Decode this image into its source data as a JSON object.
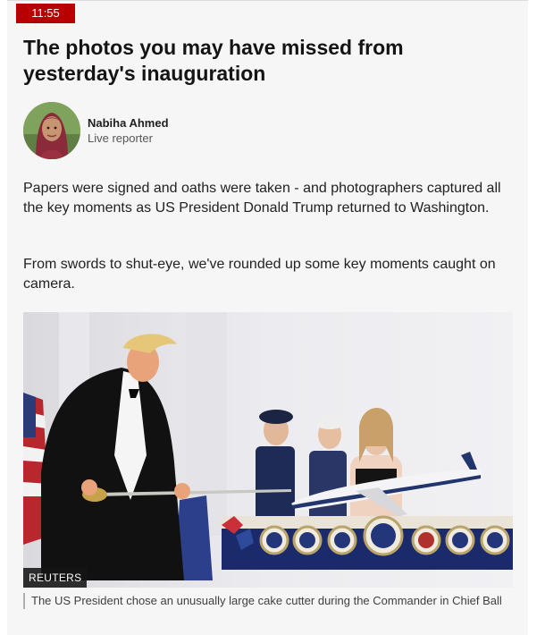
{
  "post": {
    "time": "11:55",
    "headline": "The photos you may have missed from yesterday's inauguration",
    "author": {
      "name": "Nabiha Ahmed",
      "role": "Live reporter"
    },
    "paragraphs": [
      "Papers were signed and oaths were taken - and photographers captured all the key moments as US President Donald Trump returned to Washington.",
      "From swords to shut-eye, we've rounded up some key moments caught on camera."
    ],
    "image": {
      "credit": "REUTERS",
      "caption": "The US President chose an unusually large cake cutter during the Commander in Chief Ball"
    }
  },
  "colors": {
    "badge": "#b80000",
    "background": "#f6f6f6",
    "text": "#202224"
  }
}
